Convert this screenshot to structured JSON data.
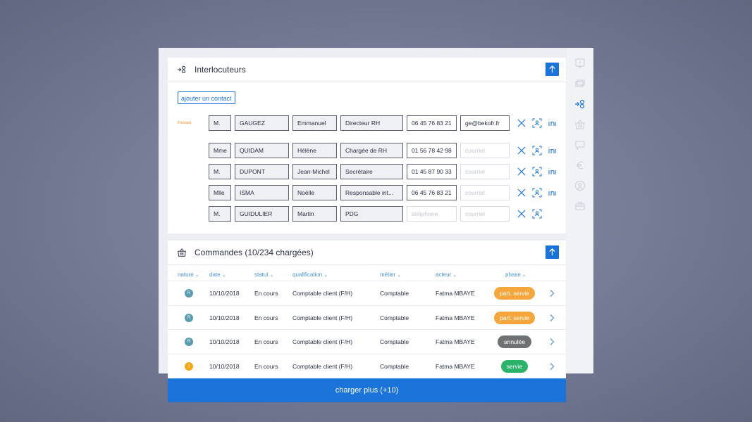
{
  "contacts_section": {
    "title": "Interlocuteurs",
    "add_button": "ajouter un contact",
    "principal_label": "Principal",
    "rows": [
      {
        "civ": "M.",
        "nom": "GAUGEZ",
        "prenom": "Emmanuel",
        "fonction": "Directeur RH",
        "tel": "06 45 76 83 21",
        "mail": "ge@bekofr.fr",
        "linkedin": true
      },
      {
        "civ": "Mme",
        "nom": "QUIDAM",
        "prenom": "Hélène",
        "fonction": "Chargée de RH",
        "tel": "01 56 78 42 98",
        "mail": "",
        "linkedin": true
      },
      {
        "civ": "M.",
        "nom": "DUPONT",
        "prenom": "Jean-Michel",
        "fonction": "Secrétaire",
        "tel": "01 45 87 90 33",
        "mail": "",
        "linkedin": true
      },
      {
        "civ": "Mlle",
        "nom": "ISMA",
        "prenom": "Noëlle",
        "fonction": "Responsable int...",
        "tel": "06 45 76 83 21",
        "mail": "",
        "linkedin": true
      },
      {
        "civ": "M.",
        "nom": "GUIDULIER",
        "prenom": "Martin",
        "fonction": "PDG",
        "tel": "",
        "mail": "",
        "linkedin": false
      }
    ],
    "placeholders": {
      "tel": "téléphone",
      "mail": "courriel"
    }
  },
  "orders_section": {
    "title": "Commandes (10/234 chargées)",
    "columns": [
      "nature",
      "date",
      "statut",
      "qualification",
      "métier",
      "acteur",
      "phase"
    ],
    "rows": [
      {
        "nature": "R",
        "nature_color": "#5a9bb0",
        "date": "10/10/2018",
        "statut": "En cours",
        "qualification": "Comptable client (F/H)",
        "metier": "Comptable",
        "acteur": "Fatma MBAYE",
        "phase": "part. servie",
        "phase_color": "#f5a63d"
      },
      {
        "nature": "R",
        "nature_color": "#5a9bb0",
        "date": "10/10/2018",
        "statut": "En cours",
        "qualification": "Comptable client (F/H)",
        "metier": "Comptable",
        "acteur": "Fatma MBAYE",
        "phase": "part. servie",
        "phase_color": "#f5a63d"
      },
      {
        "nature": "R",
        "nature_color": "#5a9bb0",
        "date": "10/10/2018",
        "statut": "En cours",
        "qualification": "Comptable client (F/H)",
        "metier": "Comptable",
        "acteur": "Fatma MBAYE",
        "phase": "annulée",
        "phase_color": "#6f7275"
      },
      {
        "nature": "!",
        "nature_color": "#f2a81d",
        "date": "10/10/2018",
        "statut": "En cours",
        "qualification": "Comptable client (F/H)",
        "metier": "Comptable",
        "acteur": "Fatma MBAYE",
        "phase": "servie",
        "phase_color": "#2bb36a"
      }
    ],
    "load_more": "charger plus (+10)"
  },
  "colors": {
    "accent": "#1a73d9",
    "principal": "#f08a24"
  },
  "side_rail_icons": [
    "alert-icon",
    "money-exchange-icon",
    "contacts-icon",
    "orders-icon",
    "chat-icon",
    "euro-icon",
    "user-circle-icon",
    "briefcase-icon"
  ]
}
